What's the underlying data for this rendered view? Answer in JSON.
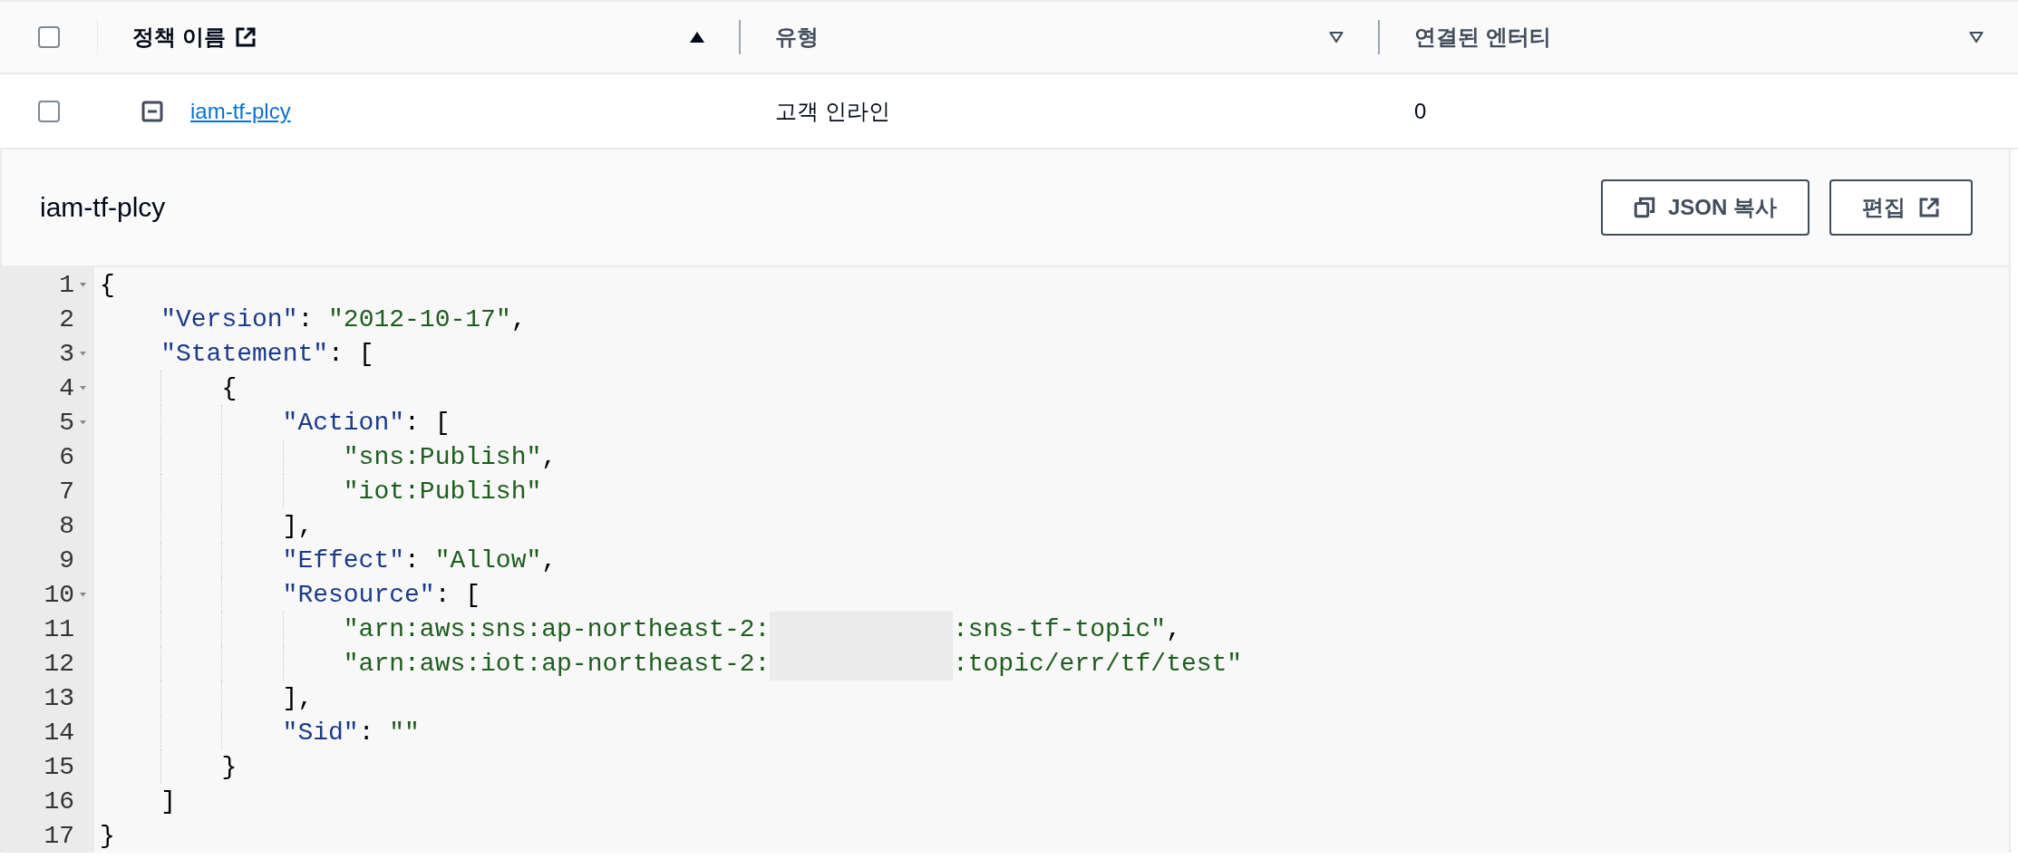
{
  "table": {
    "header_checked": false,
    "columns": [
      {
        "label": "정책 이름",
        "kind": "link",
        "sorted": true
      },
      {
        "label": "유형",
        "kind": "plain",
        "sorted": false
      },
      {
        "label": "연결된 엔터티",
        "kind": "plain",
        "sorted": false
      }
    ],
    "rows": [
      {
        "selected": false,
        "expanded": true,
        "name": "iam-tf-plcy",
        "type": "고객 인라인",
        "entities": "0"
      }
    ]
  },
  "detail": {
    "title": "iam-tf-plcy",
    "buttons": [
      {
        "label": "JSON 복사",
        "kind": "copy"
      },
      {
        "label": "편집",
        "kind": "external"
      }
    ],
    "code": [
      {
        "number": "1",
        "foldable": true,
        "tokens": [
          {
            "kind": "punct",
            "text": "{"
          }
        ],
        "children": [
          {
            "number": "2",
            "foldable": false,
            "tokens": [
              {
                "kind": "key",
                "text": "\"Version\""
              },
              {
                "kind": "punct",
                "text": ": "
              },
              {
                "kind": "string",
                "text": "\"2012-10-17\""
              },
              {
                "kind": "punct",
                "text": ","
              }
            ]
          },
          {
            "number": "3",
            "foldable": true,
            "tokens": [
              {
                "kind": "key",
                "text": "\"Statement\""
              },
              {
                "kind": "punct",
                "text": ": ["
              }
            ],
            "children": [
              {
                "number": "4",
                "foldable": true,
                "tokens": [
                  {
                    "kind": "punct",
                    "text": "{"
                  }
                ],
                "children": [
                  {
                    "number": "5",
                    "foldable": true,
                    "tokens": [
                      {
                        "kind": "key",
                        "text": "\"Action\""
                      },
                      {
                        "kind": "punct",
                        "text": ": ["
                      }
                    ],
                    "children": [
                      {
                        "number": "6",
                        "foldable": false,
                        "tokens": [
                          {
                            "kind": "string",
                            "text": "\"sns:Publish\""
                          },
                          {
                            "kind": "punct",
                            "text": ","
                          }
                        ]
                      },
                      {
                        "number": "7",
                        "foldable": false,
                        "tokens": [
                          {
                            "kind": "string",
                            "text": "\"iot:Publish\""
                          }
                        ]
                      }
                    ]
                  },
                  {
                    "number": "8",
                    "foldable": false,
                    "tokens": [
                      {
                        "kind": "punct",
                        "text": "],"
                      }
                    ]
                  },
                  {
                    "number": "9",
                    "foldable": false,
                    "tokens": [
                      {
                        "kind": "key",
                        "text": "\"Effect\""
                      },
                      {
                        "kind": "punct",
                        "text": ": "
                      },
                      {
                        "kind": "string",
                        "text": "\"Allow\""
                      },
                      {
                        "kind": "punct",
                        "text": ","
                      }
                    ]
                  },
                  {
                    "number": "10",
                    "foldable": true,
                    "tokens": [
                      {
                        "kind": "key",
                        "text": "\"Resource\""
                      },
                      {
                        "kind": "punct",
                        "text": ": ["
                      }
                    ],
                    "children": [
                      {
                        "number": "11",
                        "foldable": false,
                        "tokens": [
                          {
                            "kind": "string",
                            "text": "\"arn:aws:sns:ap-northeast-2:"
                          },
                          {
                            "kind": "redacted"
                          },
                          {
                            "kind": "string",
                            "text": ":sns-tf-topic\""
                          },
                          {
                            "kind": "punct",
                            "text": ","
                          }
                        ]
                      },
                      {
                        "number": "12",
                        "foldable": false,
                        "tokens": [
                          {
                            "kind": "string",
                            "text": "\"arn:aws:iot:ap-northeast-2:"
                          },
                          {
                            "kind": "redacted"
                          },
                          {
                            "kind": "string",
                            "text": ":topic/err/tf/test\""
                          }
                        ]
                      }
                    ]
                  },
                  {
                    "number": "13",
                    "foldable": false,
                    "tokens": [
                      {
                        "kind": "punct",
                        "text": "],"
                      }
                    ]
                  },
                  {
                    "number": "14",
                    "foldable": false,
                    "tokens": [
                      {
                        "kind": "key",
                        "text": "\"Sid\""
                      },
                      {
                        "kind": "punct",
                        "text": ": "
                      },
                      {
                        "kind": "string",
                        "text": "\"\""
                      }
                    ]
                  }
                ]
              },
              {
                "number": "15",
                "foldable": false,
                "tokens": [
                  {
                    "kind": "punct",
                    "text": "}"
                  }
                ]
              }
            ]
          },
          {
            "number": "16",
            "foldable": false,
            "tokens": [
              {
                "kind": "punct",
                "text": "]"
              }
            ]
          }
        ]
      },
      {
        "number": "17",
        "foldable": false,
        "tokens": [
          {
            "kind": "punct",
            "text": "}"
          }
        ]
      }
    ]
  }
}
